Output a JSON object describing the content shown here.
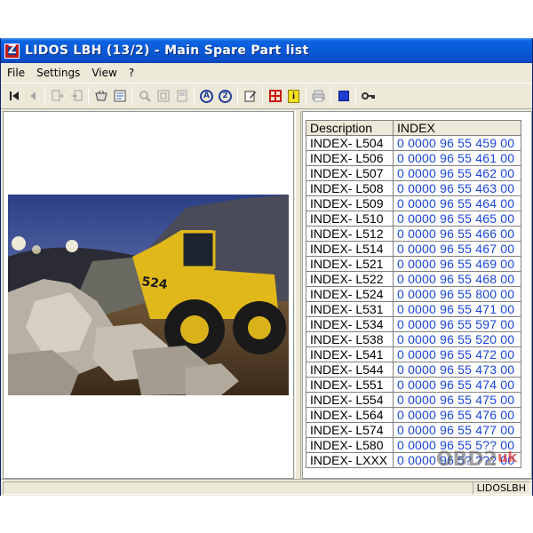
{
  "window": {
    "title": "LIDOS LBH (13/2) - Main Spare Part list"
  },
  "menu": {
    "items": [
      "File",
      "Settings",
      "View",
      "?"
    ]
  },
  "toolbar": {
    "icons": [
      "first-record-icon",
      "previous-record-icon",
      "export-icon",
      "import-icon",
      "basket-icon",
      "document-list-icon",
      "zoom-in-icon",
      "fit-page-icon",
      "page-view-icon",
      "circle-a-icon",
      "circle-2-icon",
      "edit-icon",
      "grid-icon",
      "info-icon",
      "print-icon",
      "blue-square-icon",
      "key-icon"
    ],
    "circle_a": "A",
    "circle_2": "2",
    "info": "i"
  },
  "table": {
    "headers": {
      "description": "Description",
      "index": "INDEX"
    },
    "rows": [
      {
        "description": "INDEX- L504",
        "index": "0 0000  96 55 459 00"
      },
      {
        "description": "INDEX- L506",
        "index": "0 0000  96 55 461 00"
      },
      {
        "description": "INDEX- L507",
        "index": "0 0000  96 55 462 00"
      },
      {
        "description": "INDEX- L508",
        "index": "0 0000  96 55 463 00"
      },
      {
        "description": "INDEX- L509",
        "index": "0 0000  96 55 464 00"
      },
      {
        "description": "INDEX- L510",
        "index": "0 0000  96 55 465 00"
      },
      {
        "description": "INDEX- L512",
        "index": "0 0000  96 55 466 00"
      },
      {
        "description": "INDEX- L514",
        "index": "0 0000  96 55 467 00"
      },
      {
        "description": "INDEX- L521",
        "index": "0 0000  96 55 469 00"
      },
      {
        "description": "INDEX- L522",
        "index": "0 0000  96 55 468 00"
      },
      {
        "description": "INDEX- L524",
        "index": "0 0000  96 55 800 00"
      },
      {
        "description": "INDEX- L531",
        "index": "0 0000  96 55 471 00"
      },
      {
        "description": "INDEX- L534",
        "index": "0 0000  96 55 597 00"
      },
      {
        "description": "INDEX- L538",
        "index": "0 0000  96 55 520 00"
      },
      {
        "description": "INDEX- L541",
        "index": "0 0000  96 55 472 00"
      },
      {
        "description": "INDEX- L544",
        "index": "0 0000  96 55 473 00"
      },
      {
        "description": "INDEX- L551",
        "index": "0 0000  96 55 474 00"
      },
      {
        "description": "INDEX- L554",
        "index": "0 0000  96 55 475 00"
      },
      {
        "description": "INDEX- L564",
        "index": "0 0000  96 55 476 00"
      },
      {
        "description": "INDEX- L574",
        "index": "0 0000  96 55 477 00"
      },
      {
        "description": "INDEX- L580",
        "index": "0 0000  96 55 5?? 00"
      },
      {
        "description": "INDEX- LXXX",
        "index": "0 0000  96 5? ??? 00"
      }
    ]
  },
  "watermark": {
    "text": "OBD2",
    "suffix": "uk"
  },
  "photo": {
    "loader_label": "524"
  },
  "statusbar": {
    "label": "LIDOSLBH"
  },
  "colors": {
    "title_blue": "#0a5ad8",
    "index_blue": "#1a45d8",
    "chrome": "#ece9d8"
  }
}
